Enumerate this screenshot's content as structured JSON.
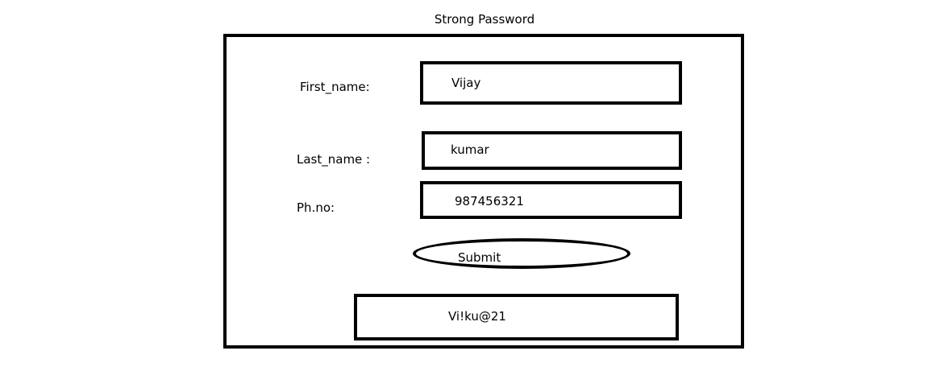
{
  "page": {
    "title": "Strong Password"
  },
  "form": {
    "first_name": {
      "label": "First_name:",
      "value": "Vijay"
    },
    "last_name": {
      "label": "Last_name :",
      "value": "kumar"
    },
    "phone": {
      "label": "Ph.no:",
      "value": "987456321"
    },
    "submit_label": "Submit",
    "generated_password": "Vi!ku@21"
  }
}
